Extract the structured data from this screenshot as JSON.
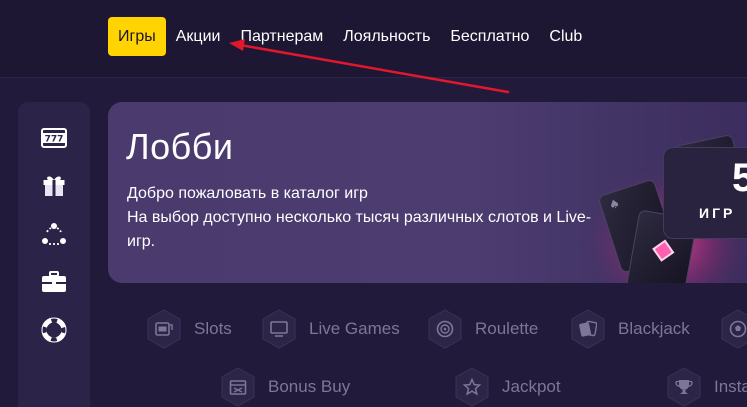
{
  "nav": {
    "items": [
      {
        "label": "Игры",
        "active": true
      },
      {
        "label": "Акции",
        "active": false
      },
      {
        "label": "Партнерам",
        "active": false
      },
      {
        "label": "Лояльность",
        "active": false
      },
      {
        "label": "Бесплатно",
        "active": false
      },
      {
        "label": "Club",
        "active": false
      }
    ]
  },
  "sidebar": {
    "icons": [
      "slots-777-icon",
      "gift-icon",
      "users-network-icon",
      "briefcase-icon",
      "lifebuoy-icon"
    ]
  },
  "hero": {
    "title": "Лобби",
    "line1": "Добро пожаловать в каталог игр",
    "line2": "На выбор доступно несколько тысяч различных слотов и Live-",
    "line3": "игр.",
    "badge_number": "5",
    "badge_label": "ИГР"
  },
  "categories": {
    "row1": [
      {
        "label": "Slots",
        "icon": "slot-machine-icon"
      },
      {
        "label": "Live Games",
        "icon": "tv-icon"
      },
      {
        "label": "Roulette",
        "icon": "roulette-icon"
      },
      {
        "label": "Blackjack",
        "icon": "cards-icon"
      }
    ],
    "row2": [
      {
        "label": "Bonus Buy",
        "icon": "bonus-buy-icon"
      },
      {
        "label": "Jackpot",
        "icon": "star-icon"
      },
      {
        "label": "Insta",
        "icon": "trophy-icon"
      }
    ]
  },
  "colors": {
    "background": "#221a3b",
    "accent": "#ffd400",
    "annotation_arrow": "#e0182d",
    "category_text": "#7d7699"
  }
}
